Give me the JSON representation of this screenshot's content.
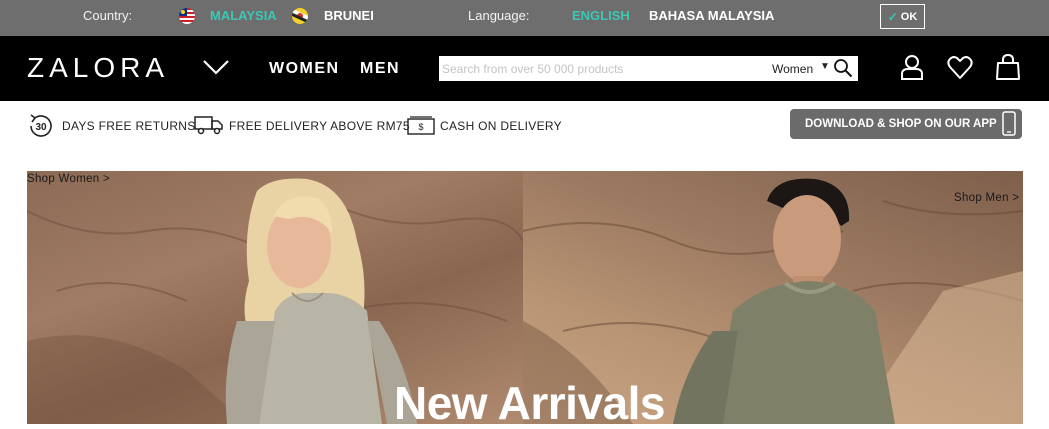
{
  "topbar": {
    "country_label": "Country:",
    "countries": [
      {
        "name": "MALAYSIA",
        "active": true,
        "flag": "malaysia-flag-icon"
      },
      {
        "name": "BRUNEI",
        "active": false,
        "flag": "brunei-flag-icon"
      }
    ],
    "language_label": "Language:",
    "languages": [
      {
        "name": "ENGLISH",
        "active": true
      },
      {
        "name": "BAHASA MALAYSIA",
        "active": false
      }
    ],
    "ok_label": "OK",
    "accent_color": "#3cc8b4"
  },
  "header": {
    "logo": "ZALORA",
    "nav": [
      "WOMEN",
      "MEN"
    ],
    "search": {
      "placeholder": "Search from over 50 000 products",
      "value": "",
      "category": "Women"
    },
    "icons": [
      "user-icon",
      "heart-icon",
      "bag-icon"
    ]
  },
  "usp": {
    "returns_badge": "30",
    "returns": "DAYS FREE RETURNS",
    "delivery": "FREE DELIVERY ABOVE RM75",
    "cash_symbol": "$",
    "cash": "CASH ON DELIVERY",
    "app_button": "DOWNLOAD & SHOP ON OUR APP"
  },
  "hero": {
    "shop_women": "Shop Women >",
    "shop_men": "Shop Men >",
    "headline": "New Arrivals"
  }
}
